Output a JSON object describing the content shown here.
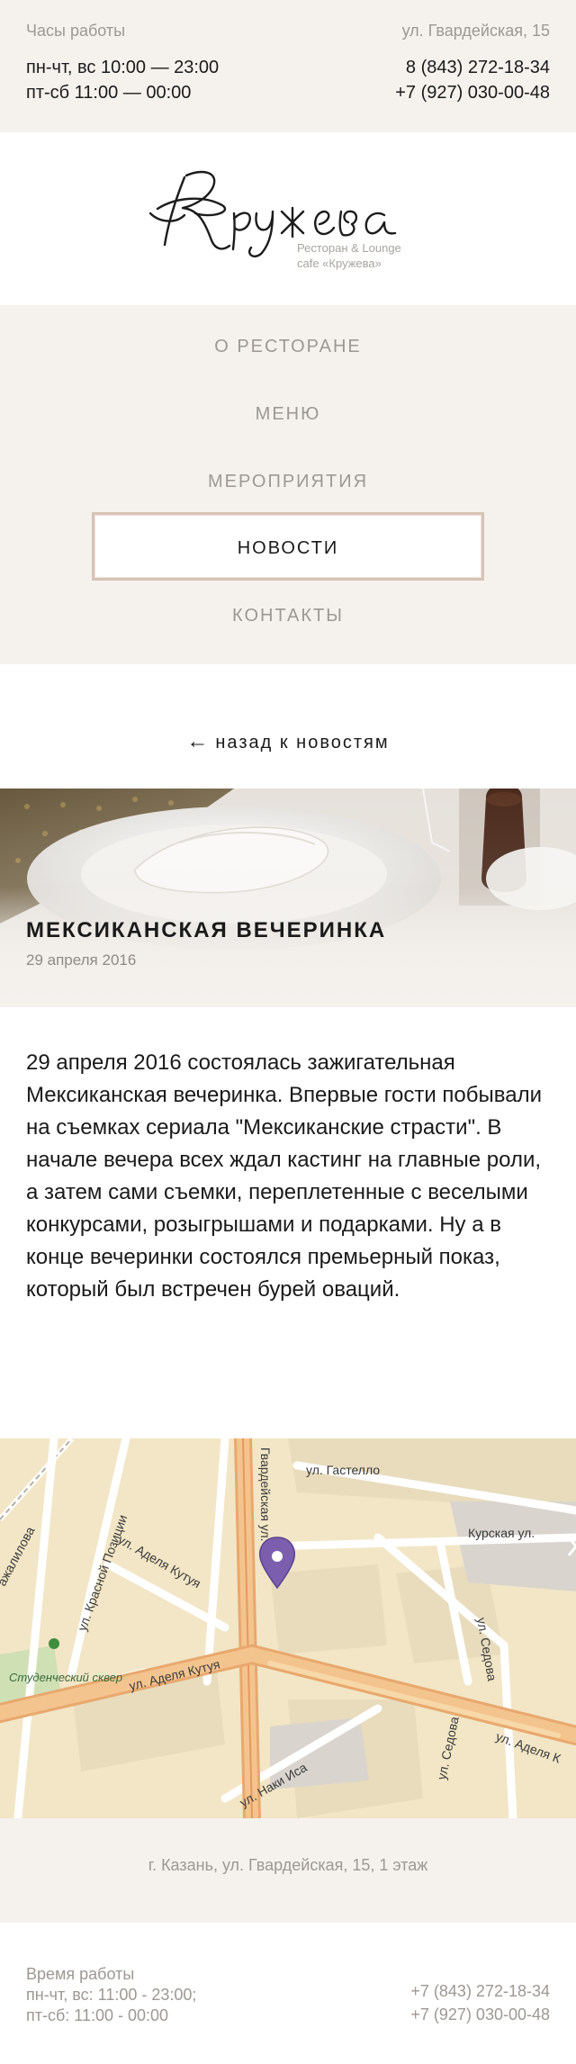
{
  "topbar": {
    "hours_label": "Часы работы",
    "hours_line1": "пн-чт, вс 10:00 — 23:00",
    "hours_line2": "пт-сб 11:00 — 00:00",
    "address": "ул. Гвардейская, 15",
    "phone1": "8 (843) 272-18-34",
    "phone2": "+7 (927) 030-00-48"
  },
  "logo": {
    "name": "Кружева",
    "subtitle_line1": "Ресторан & Lounge",
    "subtitle_line2": "cafe «Кружева»"
  },
  "nav": {
    "items": [
      {
        "label": "О РЕСТОРАНЕ",
        "active": false
      },
      {
        "label": "МЕНЮ",
        "active": false
      },
      {
        "label": "МЕРОПРИЯТИЯ",
        "active": false
      },
      {
        "label": "НОВОСТИ",
        "active": true
      },
      {
        "label": "КОНТАКТЫ",
        "active": false
      }
    ]
  },
  "back_link": {
    "label": "назад к новостям",
    "icon": "arrow-left-icon"
  },
  "article": {
    "title": "МЕКСИКАНСКАЯ ВЕЧЕРИНКА",
    "date": "29 апреля 2016",
    "body": "29 апреля 2016 состоялась зажигательная Мексиканская вечеринка. Впервые гости побывали на съемках сериала \"Мексиканские страсти\". В начале вечера всех ждал кастинг на главные роли, а затем сами съемки, переплетенные с веселыми конкурсами, розыгрышами и подарками. Ну а в конце вечеринки состоялся премьерный показ, который был встречен бурей оваций."
  },
  "map": {
    "streets": [
      "ул. Гастелло",
      "Курская ул.",
      "ул. Красной Позиции",
      "ул. Аделя Кутуя",
      "ул. Аделя Кутуя",
      "ул. Седова",
      "ул. Седова",
      "ул. Наки Иса",
      "Гвардейская ул.",
      "Студенческий сквер",
      "ул. Аделя К",
      "ажалилова"
    ],
    "marker_icon": "map-pin-icon"
  },
  "address_bar": {
    "text": "г. Казань, ул. Гвардейская, 15, 1 этаж"
  },
  "footer": {
    "hours_label": "Время работы",
    "hours_line1": "пн-чт, вс: 11:00 - 23:00;",
    "hours_line2": "пт-сб: 11:00 - 00:00",
    "phone1": "+7 (843) 272-18-34",
    "phone2": "+7 (927) 030-00-48"
  },
  "colors": {
    "beige_bg": "#f5f2ee",
    "muted_text": "#9d9893",
    "active_border": "#d8c2b6",
    "map_pin": "#7b5fae"
  }
}
